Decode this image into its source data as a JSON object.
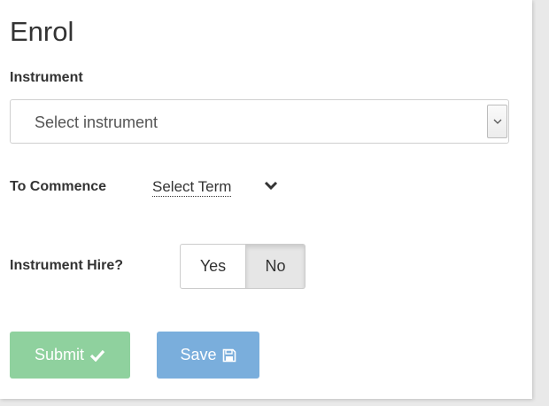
{
  "form": {
    "title": "Enrol",
    "instrument_label": "Instrument",
    "instrument_select": {
      "selected": "Select instrument",
      "icon": "chevron-down-icon"
    },
    "commence": {
      "label": "To Commence",
      "term_link": "Select Term",
      "icon": "chevron-down-icon"
    },
    "hire": {
      "label": "Instrument Hire?",
      "options": [
        "Yes",
        "No"
      ],
      "selected": "No"
    },
    "buttons": {
      "submit_label": "Submit",
      "submit_icon": "check-icon",
      "save_label": "Save",
      "save_icon": "floppy-disk-icon"
    }
  },
  "colors": {
    "submit_bg": "#8fd19e",
    "save_bg": "#7aaedc",
    "toggle_selected_bg": "#e6e6e6"
  }
}
